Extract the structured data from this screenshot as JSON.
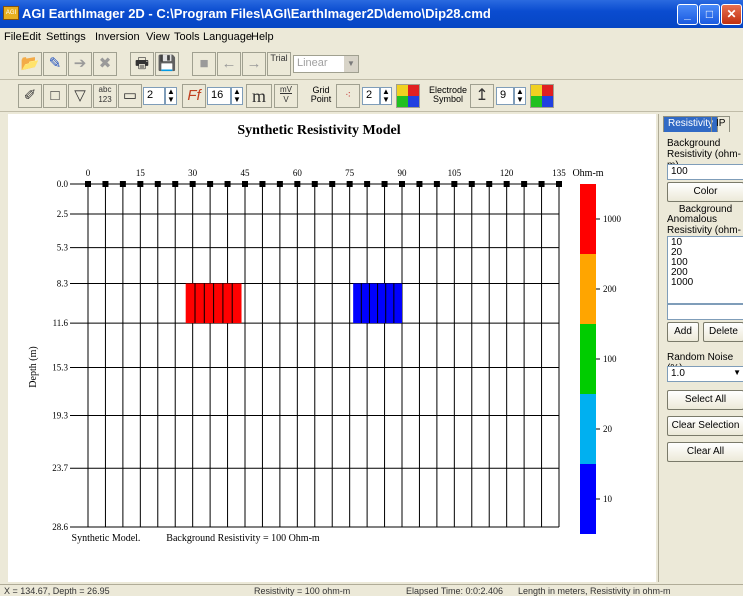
{
  "window": {
    "title": "AGI EarthImager 2D - C:\\Program Files\\AGI\\EarthImager2D\\demo\\Dip28.cmd",
    "app_icon_text": "AGI"
  },
  "menu": [
    "File",
    "Edit",
    "Settings",
    "Inversion",
    "View",
    "Tools",
    "Language",
    "Help"
  ],
  "toolbar1": {
    "trial_label": "Trial",
    "method_value": "Linear"
  },
  "toolbar2": {
    "abc_label": "abc",
    "num_label": "123",
    "line_width": "2",
    "font_size": "16",
    "unit_m": "m",
    "mv_top": "mV",
    "mv_bottom": "V",
    "grid_point_label_1": "Grid",
    "grid_point_label_2": "Point",
    "grid_point_value": "2",
    "electrode_label_1": "Electrode",
    "electrode_label_2": "Symbol",
    "electrode_value": "9"
  },
  "model": {
    "title": "Synthetic Resistivity Model",
    "x_ticks": [
      "0",
      "15",
      "30",
      "45",
      "60",
      "75",
      "90",
      "105",
      "120",
      "135"
    ],
    "y_ticks": [
      "0.0",
      "2.5",
      "5.3",
      "8.3",
      "11.6",
      "15.3",
      "19.3",
      "23.7",
      "28.6"
    ],
    "y_label": "Depth (m)",
    "footer_left": "Synthetic Model.",
    "footer_right": "Background Resistivity = 100 Ohm-m",
    "colorbar_title": "Ohm-m",
    "colorbar_labels": [
      "1000",
      "200",
      "100",
      "20",
      "10"
    ],
    "colorbar_colors": [
      "#ff0000",
      "#ffa500",
      "#00cc00",
      "#00b0f0",
      "#0000ff"
    ],
    "anomalies": [
      {
        "resistivity": 1000,
        "x_start": 28,
        "x_end": 44,
        "depth_top": 8.3,
        "depth_bottom": 11.6,
        "color": "#ff0000"
      },
      {
        "resistivity": 10,
        "x_start": 76,
        "x_end": 90,
        "depth_top": 8.3,
        "depth_bottom": 11.6,
        "color": "#0000ff"
      }
    ]
  },
  "panel": {
    "tab_resistivity": "Resistivity",
    "tab_ip": "IP",
    "bg_label_1": "Background",
    "bg_label_2": "Resistivity (ohm-m)",
    "bg_value": "100",
    "color_background_btn": "Color Background",
    "anom_label_1": "Anomalous",
    "anom_label_2": "Resistivity (ohm-m)",
    "anom_values": [
      "10",
      "20",
      "100",
      "200",
      "1000"
    ],
    "add_btn": "Add",
    "delete_btn": "Delete",
    "noise_label": "Random Noise (%)",
    "noise_value": "1.0",
    "select_all_btn": "Select All",
    "clear_selection_btn": "Clear Selection",
    "clear_all_btn": "Clear All"
  },
  "status": {
    "coords": "X = 134.67,  Depth = 26.95",
    "resistivity": "Resistivity = 100 ohm-m",
    "elapsed": "Elapsed Time:  0:0:2.406",
    "units": "Length in meters,  Resistivity in ohm-m"
  }
}
